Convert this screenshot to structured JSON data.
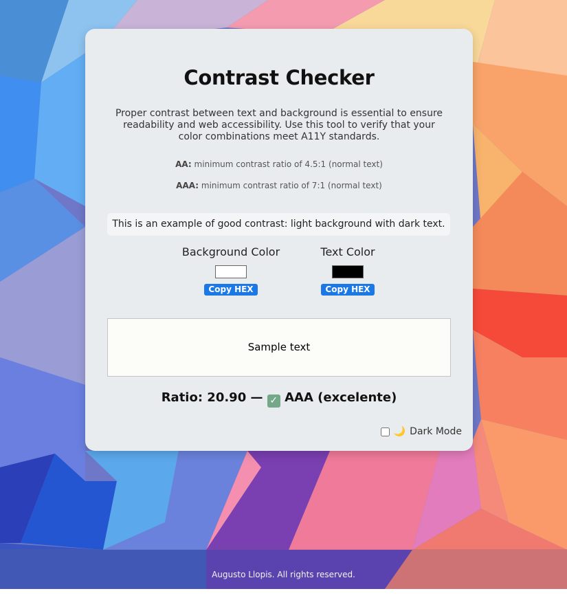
{
  "header": {
    "title": "Contrast Checker"
  },
  "intro": "Proper contrast between text and background is essential to ensure readability and web accessibility. Use this tool to verify that your color combinations meet A11Y standards.",
  "rules": [
    {
      "label": "AA:",
      "text": "minimum contrast ratio of 4.5:1 (normal text)"
    },
    {
      "label": "AAA:",
      "text": "minimum contrast ratio of 7:1 (normal text)"
    }
  ],
  "example_text": "This is an example of good contrast: light background with dark text.",
  "pickers": {
    "background": {
      "label": "Background Color",
      "color": "#ffffff",
      "button": "Copy HEX"
    },
    "text": {
      "label": "Text Color",
      "color": "#000000",
      "button": "Copy HEX"
    }
  },
  "sample": {
    "text": "Sample text",
    "bg_color": "#fcfdf8",
    "text_color": "#000000"
  },
  "result": {
    "ratio_prefix": "Ratio: 20.90 —",
    "check_icon": "check-mark-icon",
    "level": "AAA (excelente)"
  },
  "dark_mode": {
    "label": "Dark Mode",
    "checked": false,
    "icon": "crescent-moon-icon"
  },
  "footer": {
    "text": "Augusto Llopis. All rights reserved."
  },
  "colors": {
    "accent": "#1b78e4",
    "card_bg": "#e9ecee",
    "check_bg": "#74a889"
  }
}
